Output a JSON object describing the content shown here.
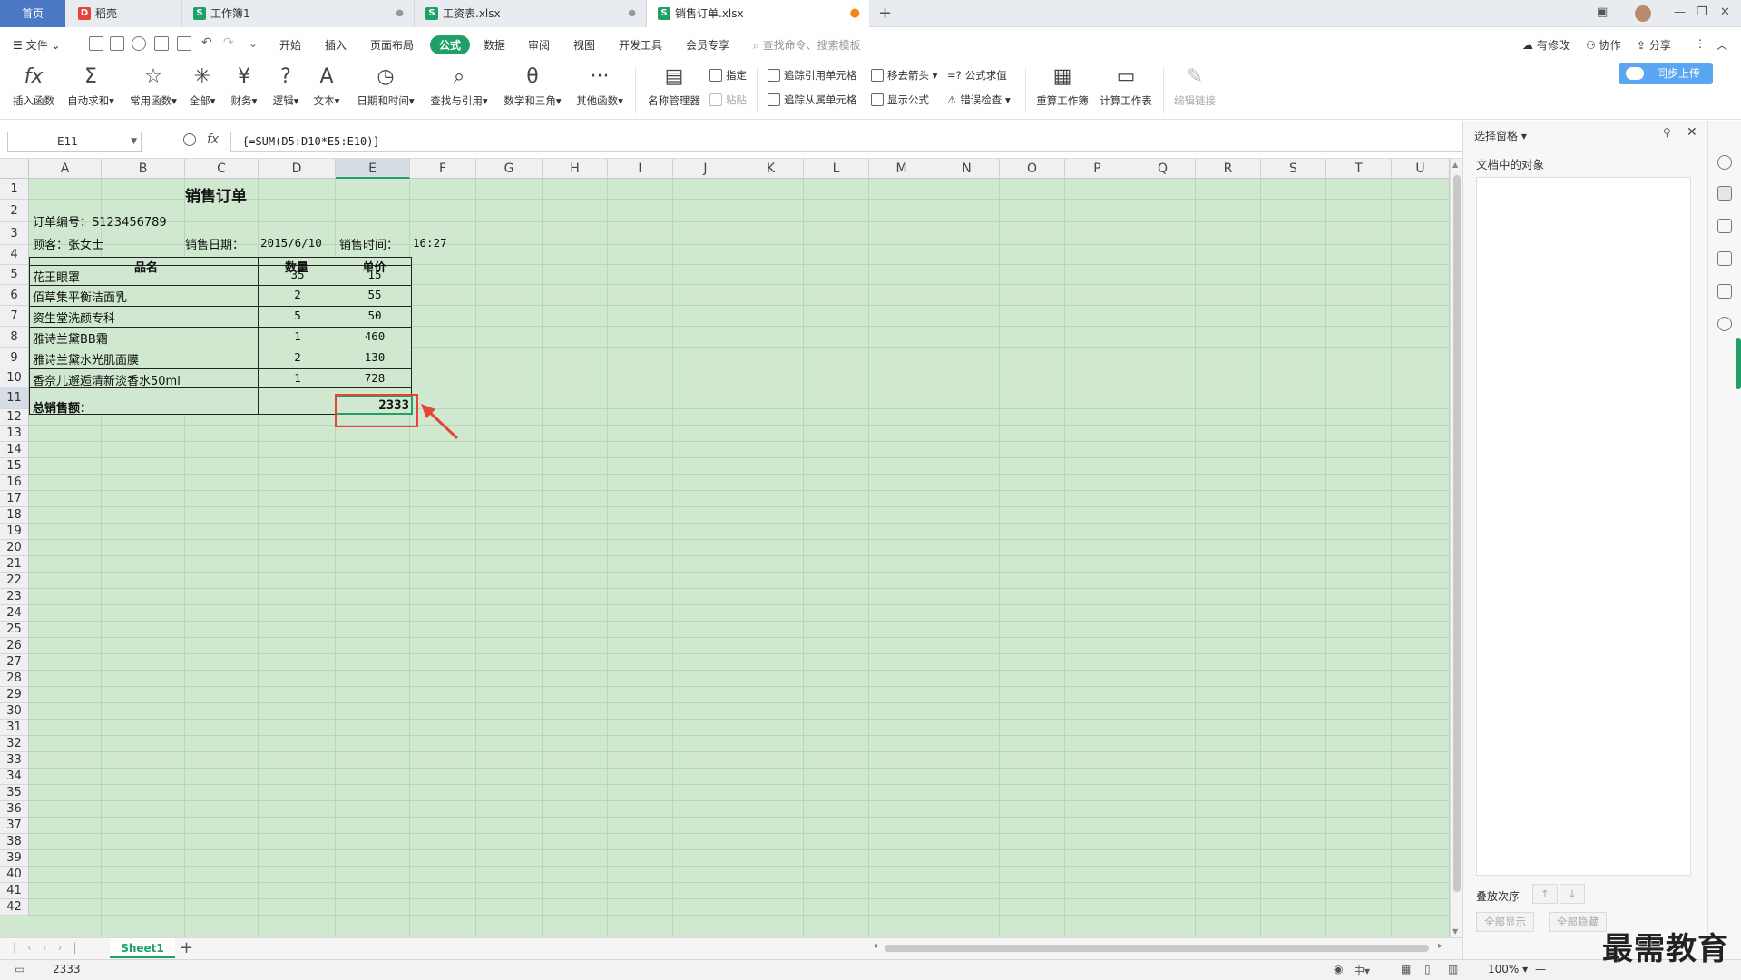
{
  "tabs": {
    "home": "首页",
    "t1": "稻壳",
    "t2": "工作簿1",
    "t3": "工资表.xlsx",
    "t4": "销售订单.xlsx"
  },
  "menu": {
    "file": "文件",
    "items": [
      "开始",
      "插入",
      "页面布局",
      "公式",
      "数据",
      "审阅",
      "视图",
      "开发工具",
      "会员专享"
    ],
    "search": "查找命令、搜索模板",
    "right": {
      "changes": "有修改",
      "collab": "协作",
      "share": "分享"
    }
  },
  "ribbon": {
    "insert_func": "插入函数",
    "autosum": "自动求和",
    "common": "常用函数",
    "all": "全部",
    "finance": "财务",
    "logic": "逻辑",
    "text": "文本",
    "datetime": "日期和时间",
    "lookup": "查找与引用",
    "math": "数学和三角",
    "other": "其他函数",
    "name_mgr": "名称管理器",
    "specify": "指定",
    "paste": "粘贴",
    "trace_prec": "追踪引用单元格",
    "trace_dep": "追踪从属单元格",
    "move_arrow": "移去箭头",
    "show_formula": "显示公式",
    "eval_formula": "公式求值",
    "error_check": "错误检查",
    "recalc_book": "重算工作簿",
    "calc_sheet": "计算工作表",
    "edit_links": "编辑链接",
    "cloud": "同步上传"
  },
  "formula_bar": {
    "name_box": "E11",
    "fx": "fx",
    "formula": "{=SUM(D5:D10*E5:E10)}"
  },
  "columns": [
    "A",
    "B",
    "C",
    "D",
    "E",
    "F",
    "G",
    "H",
    "I",
    "J",
    "K",
    "L",
    "M",
    "N",
    "O",
    "P",
    "Q",
    "R",
    "S",
    "T",
    "U"
  ],
  "rows": [
    "1",
    "2",
    "3",
    "4",
    "5",
    "6",
    "7",
    "8",
    "9",
    "10",
    "11",
    "12",
    "13",
    "14",
    "15",
    "16",
    "17",
    "18",
    "19",
    "20",
    "21",
    "22",
    "23",
    "24",
    "25",
    "26",
    "27",
    "28",
    "29",
    "30",
    "31",
    "32",
    "33",
    "34",
    "35",
    "36",
    "37",
    "38",
    "39",
    "40",
    "41",
    "42"
  ],
  "sheet": {
    "title": "销售订单",
    "order_no": "订单编号：S123456789",
    "customer": "顾客：张女士",
    "date_label": "销售日期：",
    "date_value": "2015/6/10",
    "time_label": "销售时间：",
    "time_value": "16:27",
    "headers": {
      "name": "品名",
      "qty": "数量",
      "price": "单价"
    },
    "items": [
      {
        "name": "花王眼罩",
        "qty": "35",
        "price": "15"
      },
      {
        "name": "佰草集平衡洁面乳",
        "qty": "2",
        "price": "55"
      },
      {
        "name": "资生堂洗颜专科",
        "qty": "5",
        "price": "50"
      },
      {
        "name": "雅诗兰黛BB霜",
        "qty": "1",
        "price": "460"
      },
      {
        "name": "雅诗兰黛水光肌面膜",
        "qty": "2",
        "price": "130"
      },
      {
        "name": "香奈儿邂逅清新淡香水50ml",
        "qty": "1",
        "price": "728"
      }
    ],
    "total_label": "总销售额：",
    "total_value": "2333"
  },
  "sheet_tab": "Sheet1",
  "status": {
    "value": "2333",
    "zoom": "100%"
  },
  "right_pane": {
    "title": "选择窗格",
    "objects": "文档中的对象",
    "order": "叠放次序",
    "show_all": "全部显示",
    "hide_all": "全部隐藏"
  },
  "watermark": "最需教育",
  "colors": {
    "accent": "#1fa067",
    "highlight": "#e8433a",
    "grid_bg": "#cfe8cf"
  }
}
